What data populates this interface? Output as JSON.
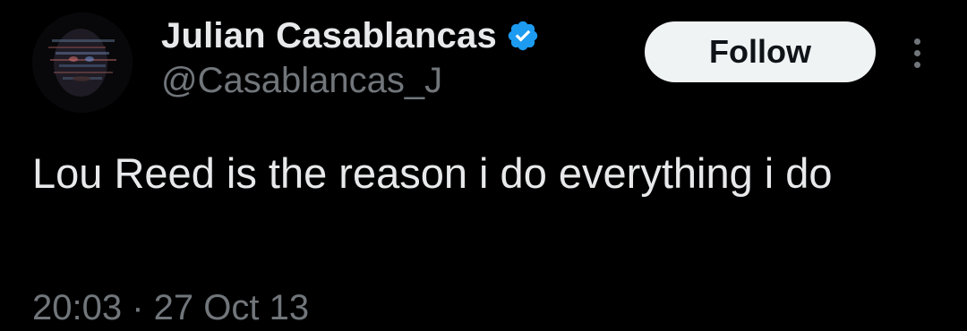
{
  "tweet": {
    "author": {
      "display_name": "Julian Casablancas",
      "handle": "@Casablancas_J",
      "verified": true,
      "avatar_icon": "profile-avatar"
    },
    "follow_label": "Follow",
    "more_icon": "more-vertical-icon",
    "text": "Lou Reed is the reason i do everything i do",
    "timestamp": "20:03 · 27 Oct 13"
  },
  "colors": {
    "background": "#000000",
    "primary_text": "#e7e9ea",
    "secondary_text": "#71767b",
    "verified_blue": "#1d9bf0",
    "follow_button_bg": "#eff3f4",
    "follow_button_text": "#0f1419"
  }
}
